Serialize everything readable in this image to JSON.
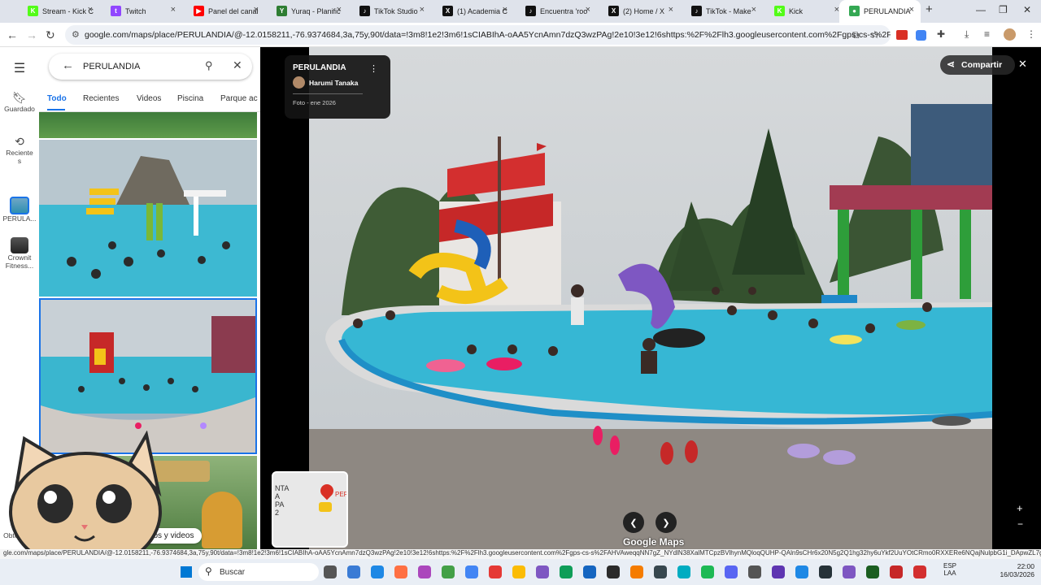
{
  "browser": {
    "tabs": [
      {
        "label": "Stream - Kick C",
        "color": "#53fc18",
        "glyph": "K"
      },
      {
        "label": "Twitch",
        "color": "#9146ff",
        "glyph": "t"
      },
      {
        "label": "Panel del canal",
        "color": "#ff0000",
        "glyph": "▶"
      },
      {
        "label": "Yuraq - Planific",
        "color": "#2e7d32",
        "glyph": "Y"
      },
      {
        "label": "TikTok Studio",
        "color": "#111111",
        "glyph": "♪"
      },
      {
        "label": "(1) Academia C",
        "color": "#111111",
        "glyph": "X"
      },
      {
        "label": "Encuentra 'roo",
        "color": "#111111",
        "glyph": "♪"
      },
      {
        "label": "(2) Home / X",
        "color": "#111111",
        "glyph": "X"
      },
      {
        "label": "TikTok - Make",
        "color": "#111111",
        "glyph": "♪"
      },
      {
        "label": "Kick",
        "color": "#53fc18",
        "glyph": "K"
      },
      {
        "label": "PERULANDIA",
        "color": "#34a853",
        "glyph": "●"
      }
    ],
    "url": "google.com/maps/place/PERULANDIA/@-12.0158211,-76.9374684,3a,75y,90t/data=!3m8!1e2!3m6!1sCIABIhA-oAA5YcnAmn7dzQ3wzPAg!2e10!3e12!6shttps:%2F%2Flh3.googleusercontent.com%2Fgps-cs-s%2FAHVAweqqNN7...",
    "status_url": "gle.com/maps/place/PERULANDIA/@-12.0158211,-76.9374684,3a,75y,90t/data=!3m8!1e2!3m6!1sCIABIhA-oAA5YcnAmn7dzQ3wzPAg!2e10!3e12!6shttps:%2F%2Flh3.googleusercontent.com%2Fgps-cs-s%2FAHVAweqqNN7gZ_NYdlN38XalMTCpzBVlhynMQloqQUHP-QAln9sCHr6x20N5g2Q1hg32hy6uYkf2UuYOtCRmo0RXXERe6NQajNulpbG1i_DApwZL7gAkgAS4z-U1NgkplugnNeZjaZxB1w3VJcZ_%3Dw203-h152-k-..."
  },
  "rail": {
    "menu_icon": "menu-icon",
    "items": [
      {
        "label": "Guardado",
        "icon": "bookmark-icon"
      },
      {
        "label": "Reciente s",
        "icon": "history-icon"
      },
      {
        "label": "PERULA...",
        "icon": "place-thumb"
      },
      {
        "label": "Crownit Fitness...",
        "icon": "place-thumb"
      },
      {
        "label": "Obten app",
        "icon": "phone-icon"
      }
    ]
  },
  "search": {
    "value": "PERULANDIA"
  },
  "filters": [
    "Todo",
    "Recientes",
    "Videos",
    "Piscina",
    "Parque ac"
  ],
  "panel": {
    "photos_button": "Fotos y videos"
  },
  "viewer": {
    "place_name": "PERULANDIA",
    "author": "Harumi Tanaka",
    "photo_date": "Foto - ene 2026",
    "share_label": "Compartir",
    "watermark": "Google Maps",
    "minimap_text": [
      "NTA",
      "A",
      "PA",
      "2"
    ],
    "minimap_pin_label": "PER"
  },
  "taskbar": {
    "search_placeholder": "Buscar",
    "lang": "ESP",
    "lang2": "LAA",
    "time": "22:00",
    "date": "16/03/2026"
  },
  "colors": {
    "pool": "#36b7d4",
    "accent": "#1a73e8",
    "dark_panel": "#000000"
  }
}
